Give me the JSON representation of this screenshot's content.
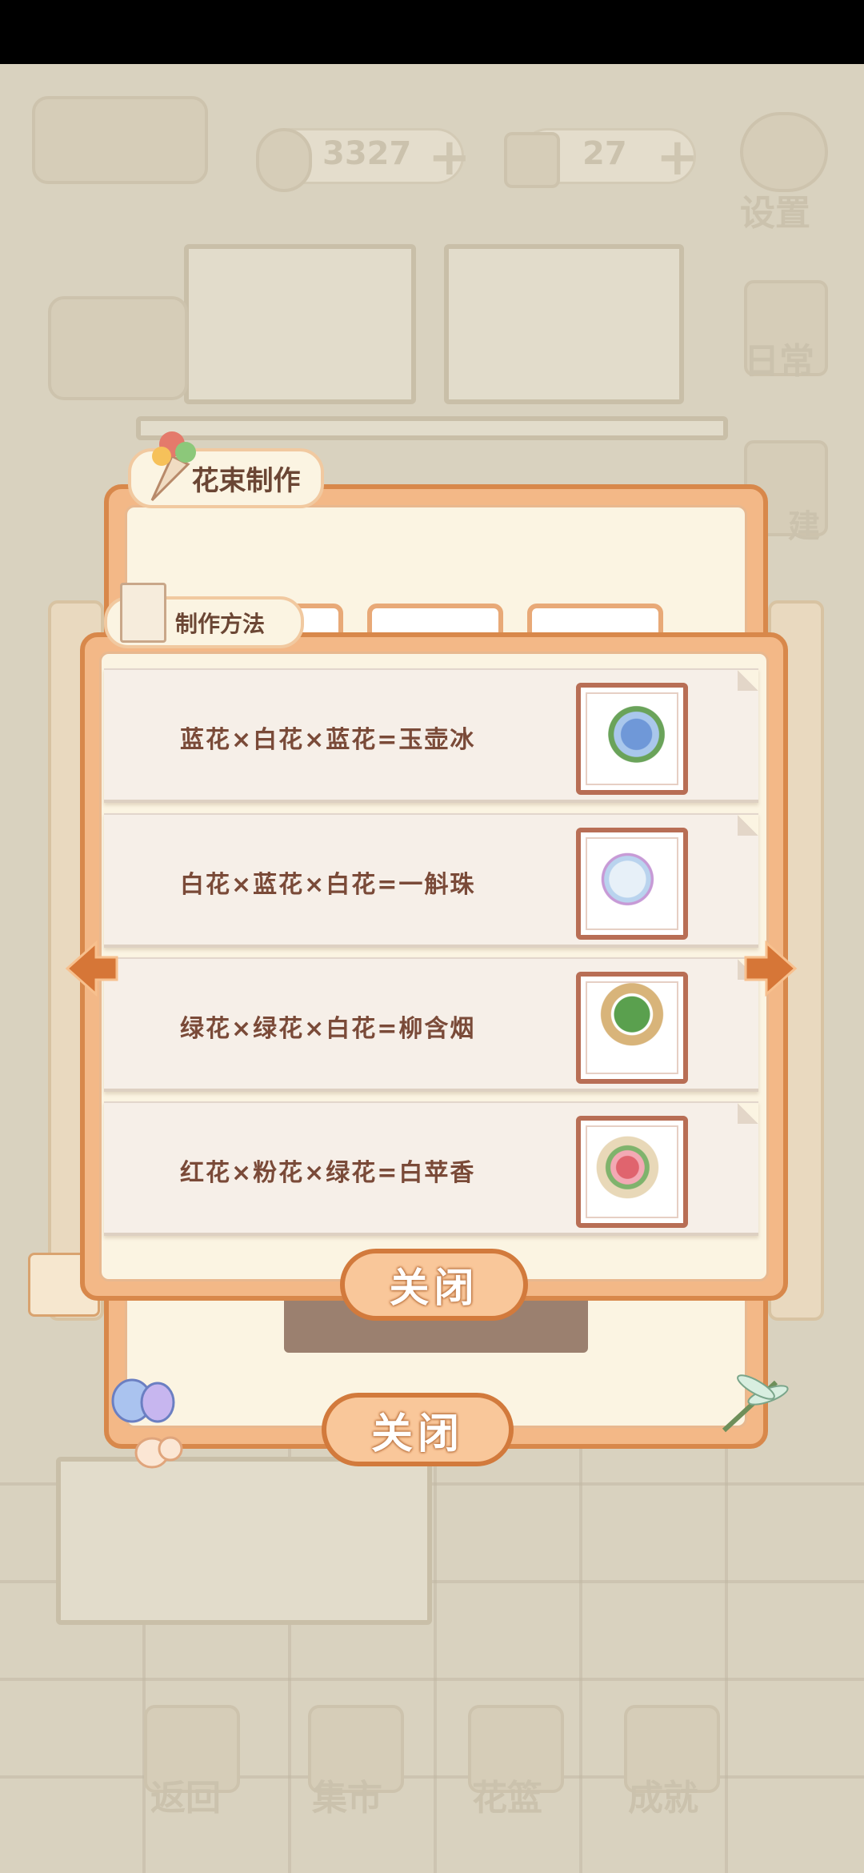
{
  "colors": {
    "panel_border": "#d8884b",
    "panel_fill": "#f3b887",
    "cream": "#fbf4e2",
    "recipe_text": "#7a4a38",
    "arrow": "#d67637"
  },
  "background": {
    "fish_count": "3327",
    "cheese_count": "27",
    "settings_label": "设置",
    "daily_label": "日常",
    "build_label": "建",
    "bottom_nav": [
      "返回",
      "集市",
      "花篮",
      "成就"
    ]
  },
  "bouquet_dialog": {
    "title": "花束制作",
    "close_label": "关闭",
    "icons": [
      "bouquet-icon",
      "butterfly-icon",
      "dragonfly-icon"
    ]
  },
  "recipe_dialog": {
    "title": "制作方法",
    "close_label": "关闭",
    "prev_icon": "left-arrow-icon",
    "next_icon": "right-arrow-icon",
    "recipes": [
      {
        "formula": "蓝花×白花×蓝花=玉壶冰",
        "image": "blue-hydrangea-bouquet",
        "swatch": "#8fb7e0"
      },
      {
        "formula": "白花×蓝花×白花=一斛珠",
        "image": "white-blue-bouquet",
        "swatch": "#d9e8f2"
      },
      {
        "formula": "绿花×绿花×白花=柳含烟",
        "image": "green-white-bouquet",
        "swatch": "#6aa85a"
      },
      {
        "formula": "红花×粉花×绿花=白苹香",
        "image": "red-pink-bouquet",
        "swatch": "#e68a92"
      }
    ]
  }
}
